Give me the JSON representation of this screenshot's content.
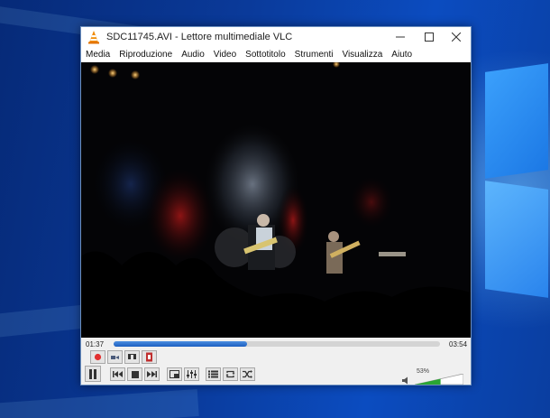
{
  "window": {
    "title": "SDC11745.AVI - Lettore multimediale VLC"
  },
  "menu": [
    {
      "label": "Media"
    },
    {
      "label": "Riproduzione"
    },
    {
      "label": "Audio"
    },
    {
      "label": "Video"
    },
    {
      "label": "Sottotitolo"
    },
    {
      "label": "Strumenti"
    },
    {
      "label": "Visualizza"
    },
    {
      "label": "Aiuto"
    }
  ],
  "playback": {
    "elapsed": "01:37",
    "total": "03:54",
    "progress": 0.41
  },
  "volume": {
    "label": "53%",
    "level": 0.53
  },
  "colors": {
    "accent": "#1d5fc0",
    "volume_green": "#2aa632",
    "record_red": "#e23030"
  }
}
